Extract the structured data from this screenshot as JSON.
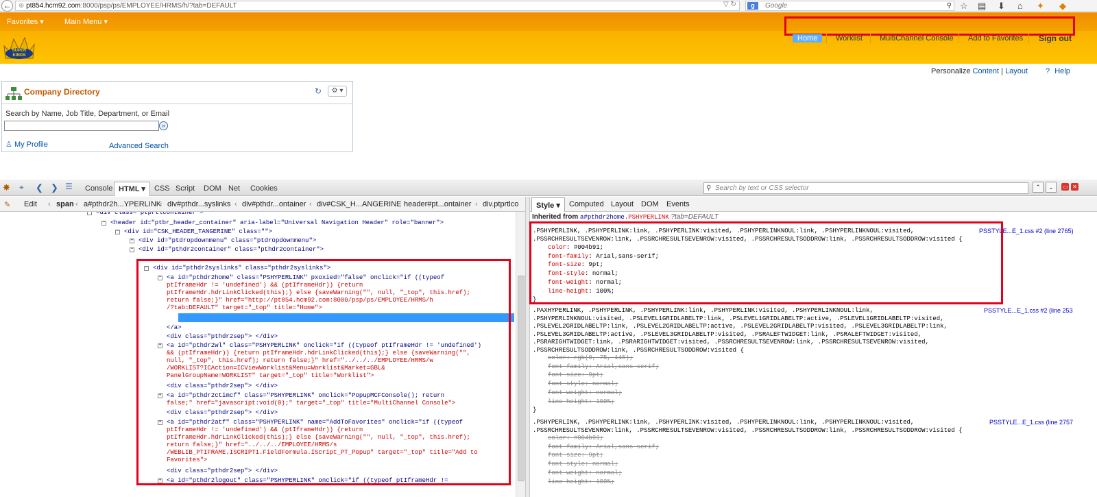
{
  "browser": {
    "url_host": "pt854.hcm92.com",
    "url_rest": ":8000/psp/ps/EMPLOYEE/HRMS/h/?tab=DEFAULT",
    "search_placeholder": "Google"
  },
  "ps_header": {
    "favorites": "Favorites",
    "main_menu": "Main Menu",
    "logo_text": "SUPER KINGS",
    "nav": [
      "Home",
      "Worklist",
      "MultiChannel Console",
      "Add to Favorites",
      "Sign out"
    ]
  },
  "personalize": {
    "label": "Personalize",
    "content": "Content",
    "sep": "|",
    "layout": "Layout",
    "help": "Help"
  },
  "company_directory": {
    "title": "Company Directory",
    "search_label": "Search by Name, Job Title, Department, or Email",
    "my_profile": "My Profile",
    "advanced_search": "Advanced Search"
  },
  "firebug": {
    "tabs": [
      "Console",
      "HTML",
      "CSS",
      "Script",
      "DOM",
      "Net",
      "Cookies"
    ],
    "active_tab": "HTML",
    "search_placeholder": "Search by text or CSS selector",
    "edit": "Edit",
    "breadcrumbs": [
      "span",
      "a#pthdr2h...YPERLINK",
      "div#pthdr...syslinks",
      "div#pthdr...ontainer",
      "div#CSK_H...ANGERINE",
      "header#pt...ontainer",
      "div.ptprtlco"
    ],
    "side_tabs": [
      "Style",
      "Computed",
      "Layout",
      "DOM",
      "Events"
    ],
    "active_side_tab": "Style",
    "inherited_label": "Inherited from",
    "inherited_element": "a#pthdr2home",
    "inherited_class": ".PSHYPERLINK",
    "inherited_title": "?tab=DEFAULT"
  },
  "html_tree": [
    "<div class=\"ptprtlcontainer\">",
    "<header id=\"ptbr_header_container\" aria-label=\"Universal Navigation Header\" role=\"banner\">",
    "<div id=\"CSK_HEADER_TANGERINE\" class=\"\">",
    "<div id=\"ptdropdownmenu\" class=\"ptdropdownmenu\">",
    "<div id=\"pthdr2container\" class=\"pthdr2container\">",
    "<div id=\"pthdr2syslinks\" class=\"pthdr2syslinks\">",
    "<a id=\"pthdr2home\" class=\"PSHYPERLINK\" pxoxied=\"false\" onclick=\"if ((typeof",
    "ptIframeHdr != 'undefined') && (ptIframeHdr)) {return",
    "ptIframeHdr.hdrLinkClicked(this);} else {saveWarning(\"\", null, \"_top\", this.href);",
    "return false;}\" href=\"http://pt854.hcm92.com:8000/psp/ps/EMPLOYEE/HRMS/h",
    "/?tab=DEFAULT\" target=\"_top\" title=\"Home\">",
    "<span>Home</span>",
    "</a>",
    "<div class=\"pthdr2sep\"> </div>",
    "<a id=\"pthdr2wl\" class=\"PSHYPERLINK\" onclick=\"if ((typeof ptIframeHdr != 'undefined')",
    "&& (ptIframeHdr)) {return ptIframeHdr.hdrLinkClicked(this);} else {saveWarning(\"\",",
    "null, \"_top\", this.href); return false;}\" href=\"../../../EMPLOYEE/HRMS/w",
    "/WORKLIST?ICAction=ICViewWorklist&Menu=Worklist&Market=GBL&",
    "PanelGroupName=WORKLIST\" target=\"_top\" title=\"Worklist\">",
    "<div class=\"pthdr2sep\"> </div>",
    "<a id=\"pthdr2ctimcf\" class=\"PSHYPERLINK\" onclick=\"PopupMCFConsole(); return",
    "false;\" href=\"javascript:void(0);\" target=\"_top\" title=\"MultiChannel Console\">",
    "<div class=\"pthdr2sep\"> </div>",
    "<a id=\"pthdr2atf\" class=\"PSHYPERLINK\" name=\"AddToFavorites\" onclick=\"if ((typeof",
    "ptIframeHdr != 'undefined') && (ptIframeHdr)) {return",
    "ptIframeHdr.hdrLinkClicked(this);} else {saveWarning(\"\", null, \"_top\", this.href);",
    "return false;}\" href=\"../../../EMPLOYEE/HRMS/s",
    "/WEBLIB_PTIFRAME.ISCRIPT1.FieldFormula.IScript_PT_Popup\" target=\"_top\" title=\"Add to",
    "Favorites\">",
    "<div class=\"pthdr2sep\"> </div>",
    "<a id=\"pthdr2logout\" class=\"PSHYPERLINK\" onclick=\"if ((typeof ptIframeHdr !="
  ],
  "style_rules": [
    {
      "source": "PSSTYLE...E_1.css #2 (line 2765)",
      "selector": [
        ".PSHYPERLINK, .PSHYPERLINK:link, .PSHYPERLINK:visited, .PSHYPERLINKNOUL:link, .PSHYPERLINKNOUL:visited,",
        ".PSSRCHRESULTSEVENROW:link, .PSSRCHRESULTSEVENROW:visited, .PSSRCHRESULTSODDROW:link, .PSSRCHRESULTSODDROW:visited {"
      ],
      "props": [
        [
          "color",
          "#004b91;"
        ],
        [
          "font-family",
          "Arial,sans-serif;"
        ],
        [
          "font-size",
          "9pt;"
        ],
        [
          "font-style",
          "normal;"
        ],
        [
          "font-weight",
          "normal;"
        ],
        [
          "line-height",
          "100%;"
        ]
      ],
      "close": "}"
    },
    {
      "source": "PSSTYLE...E_1.css #2 (line 253",
      "selector": [
        ".PAXHYPERLINK, .PSHYPERLINK, .PSHYPERLINK:link, .PSHYPERLINK:visited, .PSHYPERLINKNOUL:link,",
        ".PSHYPERLINKNOUL:visited, .PSLEVEL1GRIDLABELTP:link, .PSLEVEL1GRIDLABELTP:active, .PSLEVEL1GRIDLABELTP:visited,",
        ".PSLEVEL2GRIDLABELTP:link, .PSLEVEL2GRIDLABELTP:active, .PSLEVEL2GRIDLABELTP:visited, .PSLEVEL3GRIDLABELTP:link,",
        ".PSLEVEL3GRIDLABELTP:active, .PSLEVEL3GRIDLABELTP:visited, .PSRALEFTWIDGET:link, .PSRALEFTWIDGET:visited,",
        ".PSRARIGHTWIDGET:link, .PSRARIGHTWIDGET:visited, .PSSRCHRESULTSEVENROW:link, .PSSRCHRESULTSEVENROW:visited,",
        ".PSSRCHRESULTSODDROW:link, .PSSRCHRESULTSODDROW:visited {"
      ],
      "props": [
        [
          "color",
          "rgb(0, 75, 145);"
        ],
        [
          "font-family",
          "Arial,sans-serif;"
        ],
        [
          "font-size",
          "9pt;"
        ],
        [
          "font-style",
          "normal;"
        ],
        [
          "font-weight",
          "normal;"
        ],
        [
          "line-height",
          "100%;"
        ]
      ],
      "close": "}"
    },
    {
      "source": "PSSTYLE...E_1.css (line 2757",
      "selector": [
        ".PSHYPERLINK, .PSHYPERLINK:link, .PSHYPERLINK:visited, .PSHYPERLINKNOUL:link, .PSHYPERLINKNOUL:visited,",
        ".PSSRCHRESULTSEVENROW:link, .PSSRCHRESULTSEVENROW:visited, .PSSRCHRESULTSODDROW:link, .PSSRCHRESULTSODDROW:visited {"
      ],
      "props": [
        [
          "color",
          "#004b91;"
        ],
        [
          "font-family",
          "Arial,sans-serif;"
        ],
        [
          "font-size",
          "9pt;"
        ],
        [
          "font-style",
          "normal;"
        ],
        [
          "font-weight",
          "normal;"
        ],
        [
          "line-height",
          "100%;"
        ]
      ],
      "close": ""
    }
  ],
  "colors": {
    "highlight_red": "#e3001b",
    "orange": "#f7a600",
    "link_blue": "#0000cc",
    "selection_blue": "#3399ff"
  }
}
